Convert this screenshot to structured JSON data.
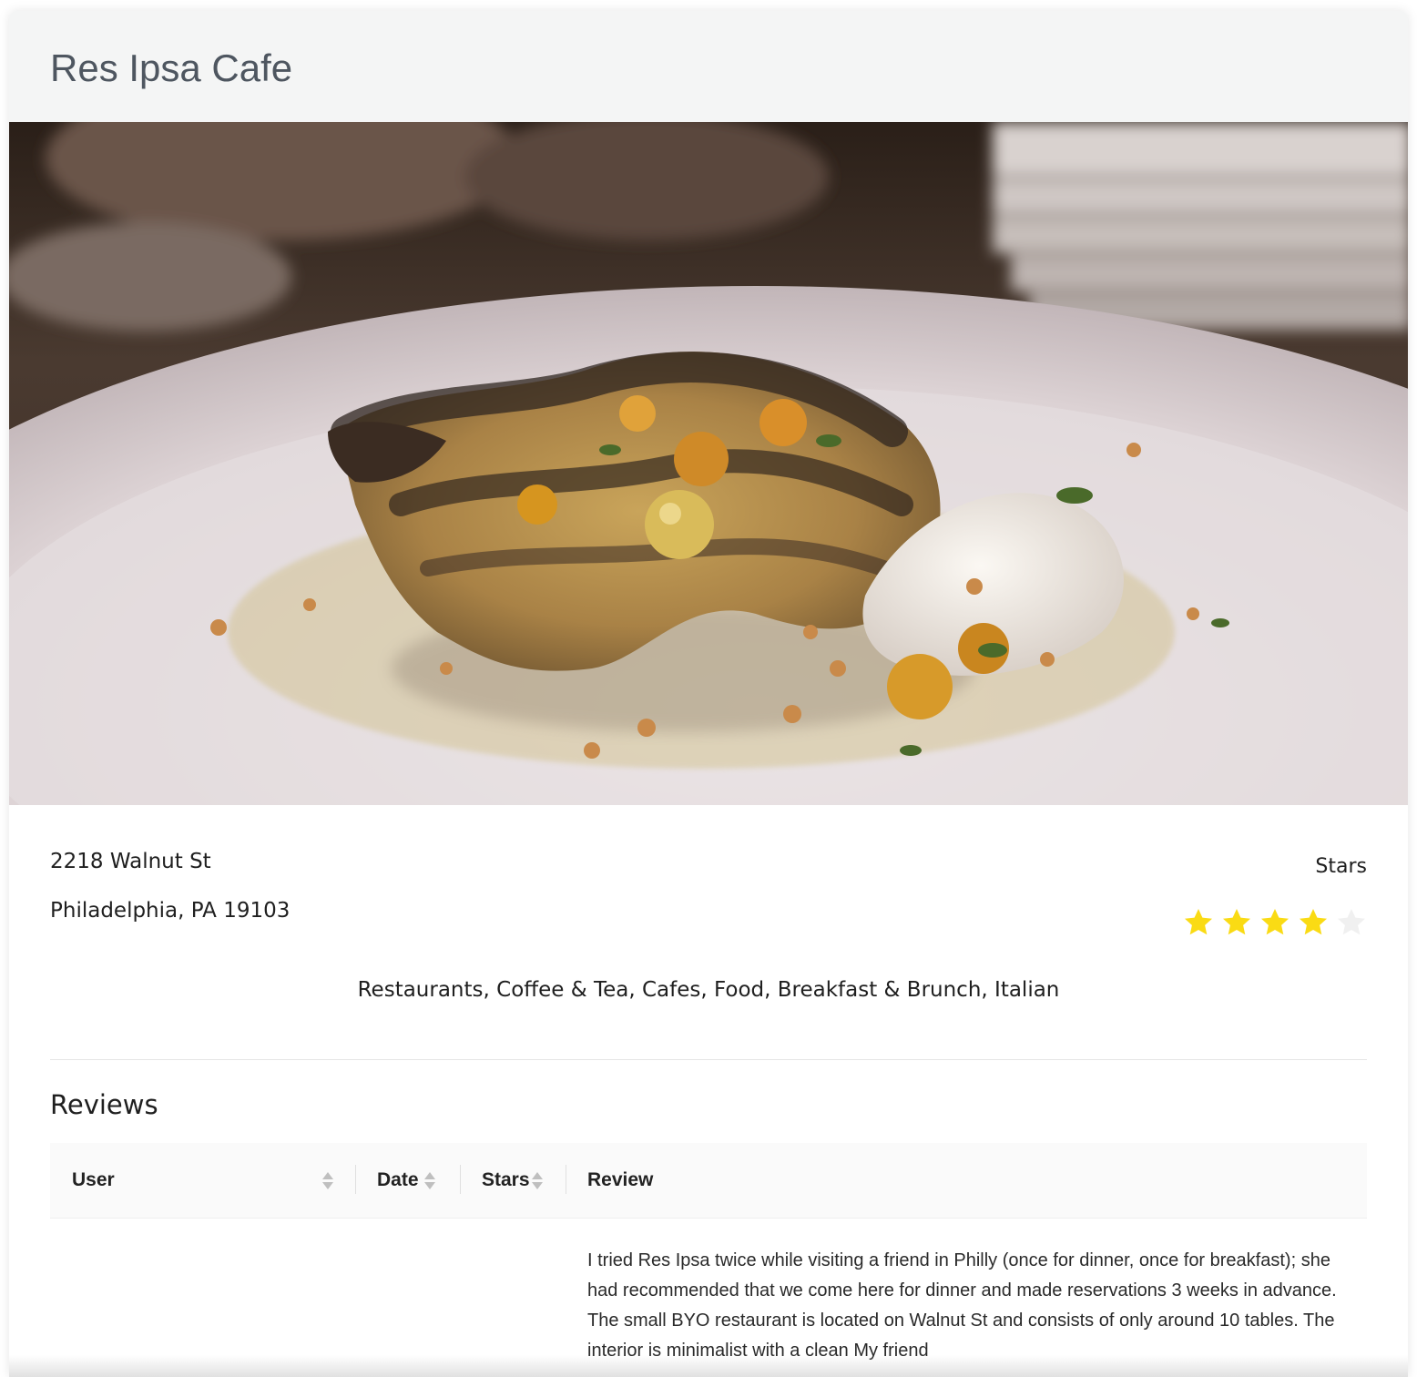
{
  "header": {
    "title": "Res Ipsa Cafe"
  },
  "hero": {
    "alt": "Grilled cauliflower steak with golden raisins, hazelnuts and whipped ricotta on a white plate"
  },
  "address": {
    "line1": "2218 Walnut St",
    "line2": "Philadelphia, PA 19103"
  },
  "rating": {
    "label": "Stars",
    "value": 4,
    "max": 5,
    "filled_color": "#fadb14",
    "empty_color": "#f0f0f0"
  },
  "categories": "Restaurants, Coffee & Tea, Cafes, Food, Breakfast & Brunch, Italian",
  "reviews": {
    "title": "Reviews",
    "columns": [
      {
        "label": "User",
        "sortable": true
      },
      {
        "label": "Date",
        "sortable": true
      },
      {
        "label": "Stars",
        "sortable": true
      },
      {
        "label": "Review",
        "sortable": false
      }
    ],
    "rows": [
      {
        "user": "",
        "date": "",
        "stars": "",
        "review": "I tried Res Ipsa twice while visiting a friend in Philly (once for dinner, once for breakfast); she had recommended that we come here for dinner and made reservations 3 weeks in advance. The small BYO restaurant is located on Walnut St and consists of only around 10 tables. The interior is minimalist with a clean My friend"
      }
    ]
  }
}
